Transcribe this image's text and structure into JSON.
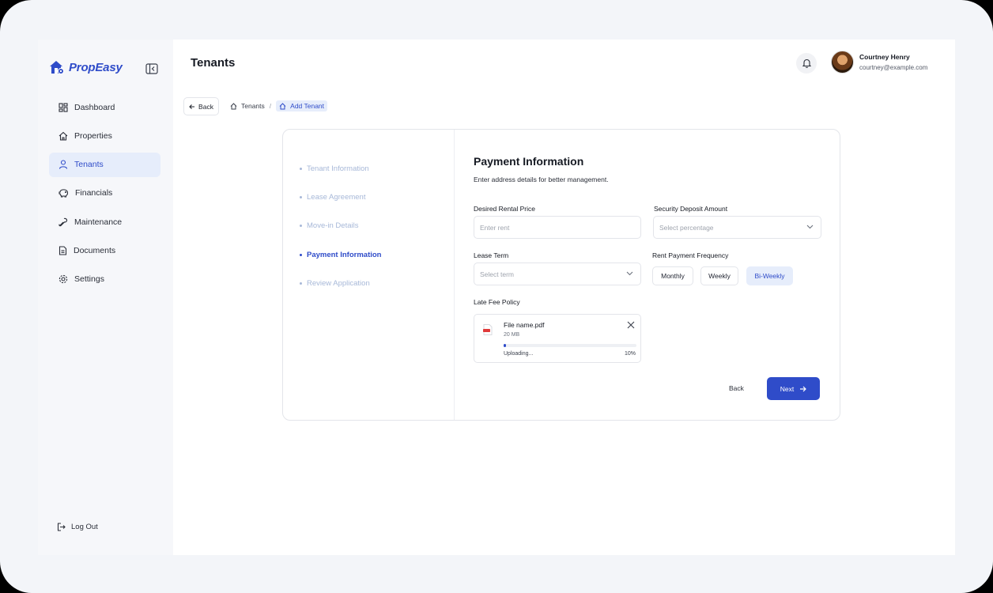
{
  "app": {
    "brand": "PropEasy",
    "page_title": "Tenants"
  },
  "sidebar": {
    "items": [
      {
        "label": "Dashboard",
        "icon": "grid-icon"
      },
      {
        "label": "Properties",
        "icon": "home-icon"
      },
      {
        "label": "Tenants",
        "icon": "user-icon",
        "active": true
      },
      {
        "label": "Financials",
        "icon": "piggy-bank-icon"
      },
      {
        "label": "Maintenance",
        "icon": "wrench-icon"
      },
      {
        "label": "Documents",
        "icon": "document-icon"
      },
      {
        "label": "Settings",
        "icon": "gear-icon"
      }
    ],
    "logout": "Log Out"
  },
  "header": {
    "user_name": "Courtney Henry",
    "user_email": "courtney@example.com"
  },
  "breadcrumb": {
    "back": "Back",
    "items": [
      "Tenants",
      "Add Tenant"
    ],
    "separator": "/"
  },
  "steps": [
    {
      "label": "Tenant Information"
    },
    {
      "label": "Lease Agreement"
    },
    {
      "label": "Move-in Details"
    },
    {
      "label": "Payment Information",
      "active": true
    },
    {
      "label": "Review Application"
    }
  ],
  "form": {
    "title": "Payment Information",
    "subtitle": "Enter address details for better management.",
    "rental_price": {
      "label": "Desired Rental Price",
      "placeholder": "Enter rent"
    },
    "security_deposit": {
      "label": "Security Deposit Amount",
      "placeholder": "Select percentage"
    },
    "lease_term": {
      "label": "Lease Term",
      "placeholder": "Select term"
    },
    "frequency": {
      "label": "Rent Payment Frequency",
      "options": [
        "Monthly",
        "Weekly",
        "Bi-Weekly"
      ],
      "selected": "Bi-Weekly"
    },
    "late_fee": {
      "label": "Late Fee Policy",
      "file_name": "File name.pdf",
      "file_size": "20 MB",
      "status": "Uploading...",
      "progress_label": "10%",
      "progress": 0.02
    },
    "back_label": "Back",
    "next_label": "Next"
  },
  "colors": {
    "accent": "#2f4cc9",
    "active_bg": "#e6edfb",
    "step_inactive": "#a7b8d8"
  }
}
